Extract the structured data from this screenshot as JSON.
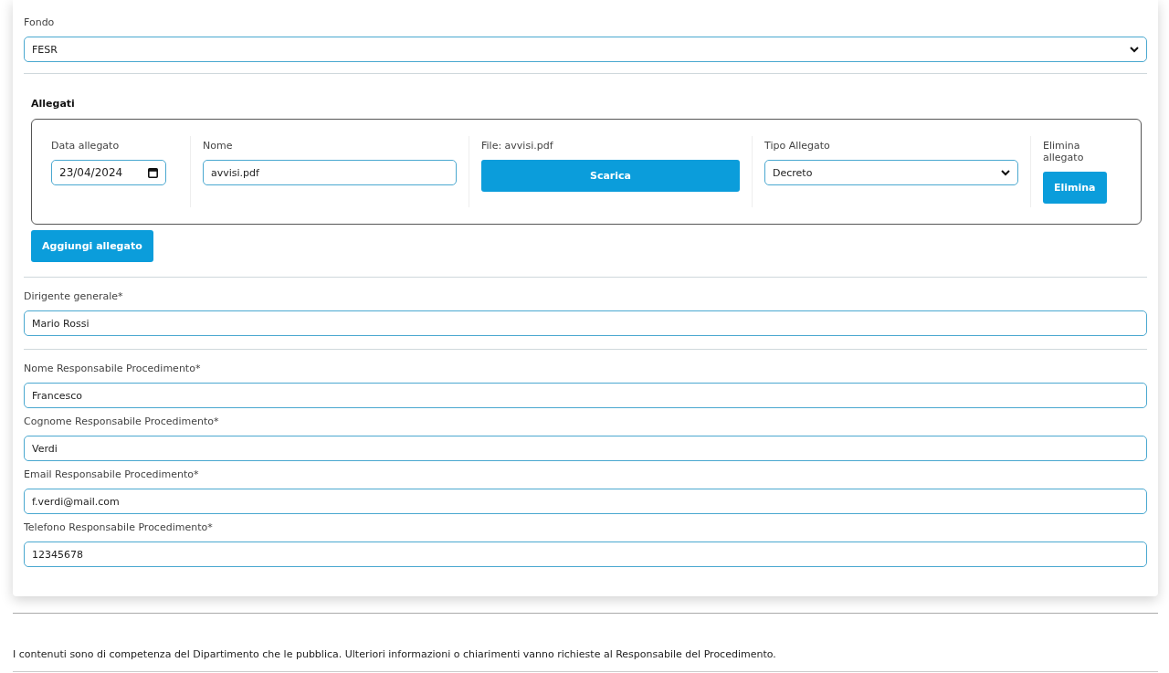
{
  "fondo": {
    "label": "Fondo",
    "value": "FESR"
  },
  "allegati": {
    "title": "Allegati",
    "rows": [
      {
        "date_label": "Data allegato",
        "date_value": "23/04/2024",
        "name_label": "Nome",
        "name_value": "avvisi.pdf",
        "file_label": "File: avvisi.pdf",
        "download_button": "Scarica",
        "type_label": "Tipo Allegato",
        "type_value": "Decreto",
        "delete_label": "Elimina allegato",
        "delete_button": "Elimina"
      }
    ],
    "add_button": "Aggiungi allegato"
  },
  "sections": [
    {
      "fields": [
        {
          "label": "Dirigente generale*",
          "value": "Mario Rossi"
        }
      ]
    },
    {
      "fields": [
        {
          "label": "Nome Responsabile Procedimento*",
          "value": "Francesco"
        },
        {
          "label": "Cognome Responsabile Procedimento*",
          "value": "Verdi"
        },
        {
          "label": "Email Responsabile Procedimento*",
          "value": "f.verdi@mail.com"
        },
        {
          "label": "Telefono Responsabile Procedimento*",
          "value": "12345678"
        }
      ]
    }
  ],
  "footer": {
    "text": "I contenuti sono di competenza del Dipartimento che le pubblica. Ulteriori informazioni o chiarimenti vanno richieste al Responsabile del Procedimento."
  }
}
